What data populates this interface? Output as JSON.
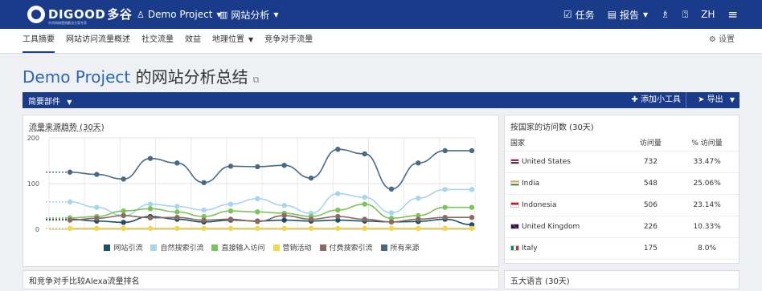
{
  "header": {
    "brand": "DIGOOD",
    "brand_cn": "多谷",
    "brand_sub": "外贸网络营销解决方案专家",
    "project": "Demo Project",
    "analytics": "网站分析",
    "tasks": "任务",
    "reports": "报告",
    "lang": "ZH",
    "icons": {
      "project": "user-icon",
      "analytics": "chart-icon",
      "tasks": "checklist-icon",
      "reports": "report-icon",
      "user": "user-add-icon",
      "help": "help-icon",
      "menu": "hamburger-icon"
    }
  },
  "subnav": {
    "tabs": [
      "工具摘要",
      "网站访问流量概述",
      "社交流量",
      "效益",
      "地理位置",
      "竞争对手流量"
    ],
    "settings": "设置"
  },
  "page": {
    "title_project": "Demo Project",
    "title_rest": " 的网站分析总结"
  },
  "toolbar": {
    "summary": "简要部件",
    "add_widget": "添加小工具",
    "export": "导出"
  },
  "traffic_panel": {
    "title": "流量来源趋势 (30天)"
  },
  "country_panel": {
    "title": "按国家的访问数 (30天)",
    "columns": [
      "国家",
      "访问量",
      "% 访问量"
    ],
    "rows": [
      {
        "country": "United States",
        "visits": "732",
        "pct": "33.47%"
      },
      {
        "country": "India",
        "visits": "548",
        "pct": "25.06%"
      },
      {
        "country": "Indonesia",
        "visits": "506",
        "pct": "23.14%"
      },
      {
        "country": "United Kingdom",
        "visits": "226",
        "pct": "10.33%"
      },
      {
        "country": "Italy",
        "visits": "175",
        "pct": "8.0%"
      }
    ]
  },
  "alexa_panel": {
    "title": "和竞争对手比较Alexa流量排名"
  },
  "language_panel": {
    "title": "五大语言 (30天)"
  },
  "chart_data": {
    "type": "line",
    "title": "流量来源趋势 (30天)",
    "ylim": [
      0,
      200
    ],
    "yticks": [
      "200",
      "100",
      "0"
    ],
    "grid": true,
    "legend_position": "bottom",
    "x": [
      1,
      2,
      3,
      4,
      5,
      6,
      7,
      8,
      9,
      10,
      11,
      12,
      13,
      14,
      15,
      16
    ],
    "series": [
      {
        "name": "网站引流",
        "color": "#1f4e6b",
        "values": [
          22,
          18,
          15,
          28,
          22,
          16,
          20,
          18,
          20,
          18,
          20,
          18,
          16,
          17,
          22,
          10
        ]
      },
      {
        "name": "自然搜索引流",
        "color": "#a6d5ee",
        "values": [
          60,
          48,
          30,
          55,
          50,
          42,
          55,
          67,
          52,
          35,
          78,
          70,
          36,
          68,
          87,
          87
        ]
      },
      {
        "name": "直接输入访问",
        "color": "#7cc45a",
        "values": [
          25,
          28,
          40,
          45,
          38,
          28,
          40,
          38,
          35,
          28,
          42,
          55,
          24,
          30,
          48,
          48
        ]
      },
      {
        "name": "营销活动",
        "color": "#f2d64b",
        "values": [
          2,
          2,
          2,
          2,
          2,
          2,
          2,
          2,
          2,
          2,
          2,
          2,
          2,
          2,
          2,
          2
        ]
      },
      {
        "name": "付费搜索引流",
        "color": "#8a6a62",
        "values": [
          20,
          24,
          30,
          25,
          26,
          20,
          22,
          17,
          30,
          22,
          28,
          22,
          16,
          22,
          26,
          26
        ]
      },
      {
        "name": "所有来源",
        "color": "#4a6a84",
        "values": [
          125,
          120,
          110,
          155,
          145,
          102,
          138,
          137,
          140,
          112,
          175,
          165,
          88,
          145,
          172,
          172
        ]
      }
    ]
  }
}
